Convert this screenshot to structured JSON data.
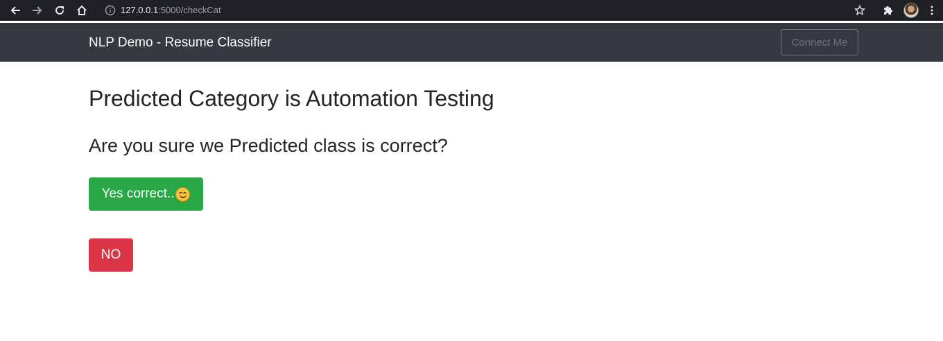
{
  "browser": {
    "url_host": "127.0.0.1",
    "url_rest": ":5000/checkCat"
  },
  "navbar": {
    "brand": "NLP Demo - Resume Classifier",
    "connect_label": "Connect Me"
  },
  "main": {
    "prediction_title": "Predicted Category is Automation Testing",
    "question": "Are you sure we Predicted class is correct?",
    "yes_label": "Yes correct..",
    "no_label": "NO"
  },
  "colors": {
    "navbar_bg": "#343a40",
    "yes_button": "#28a745",
    "no_button": "#dc3545"
  },
  "icons": [
    "back-arrow-icon",
    "forward-arrow-icon",
    "reload-icon",
    "home-icon",
    "info-icon",
    "star-icon",
    "puzzle-icon",
    "kebab-menu-icon",
    "smile-emoji-icon"
  ]
}
